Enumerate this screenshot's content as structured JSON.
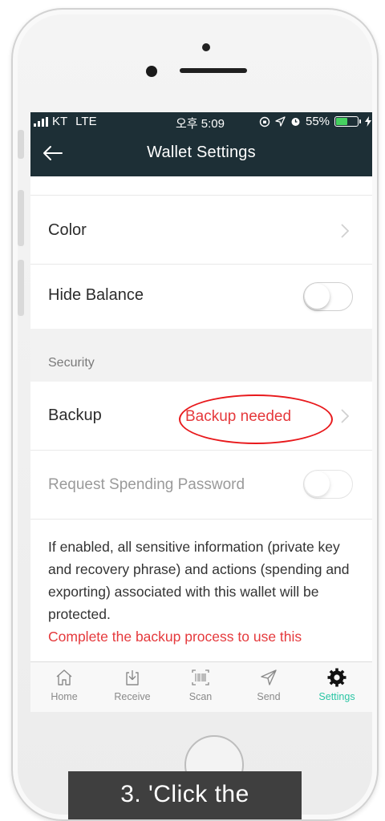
{
  "status_bar": {
    "carrier": "KT",
    "network": "LTE",
    "time": "오후 5:09",
    "battery_percent": "55%",
    "battery_level": 0.55,
    "battery_color": "#46d160"
  },
  "nav": {
    "title": "Wallet Settings",
    "back_icon": "arrow-left-icon"
  },
  "settings": {
    "color_label": "Color",
    "hide_balance_label": "Hide Balance",
    "hide_balance_enabled": false,
    "security_section": "Security",
    "backup_label": "Backup",
    "backup_status": "Backup needed",
    "request_password_label": "Request Spending Password",
    "request_password_enabled": false,
    "description": "If enabled, all sensitive information (private key and recovery phrase) and actions (spending and exporting) associated with this wallet will be protected.",
    "warning": "Complete the backup process to use this"
  },
  "tabs": [
    {
      "label": "Home",
      "icon": "home-icon"
    },
    {
      "label": "Receive",
      "icon": "receive-icon"
    },
    {
      "label": "Scan",
      "icon": "barcode-scan-icon"
    },
    {
      "label": "Send",
      "icon": "send-icon"
    },
    {
      "label": "Settings",
      "icon": "gear-icon"
    }
  ],
  "active_tab": "Settings",
  "caption": "3. 'Click the",
  "colors": {
    "header_bg": "#1d2f36",
    "accent": "#2ac5a4",
    "alert_red": "#e5393c",
    "annotation_red": "#e8191c"
  }
}
